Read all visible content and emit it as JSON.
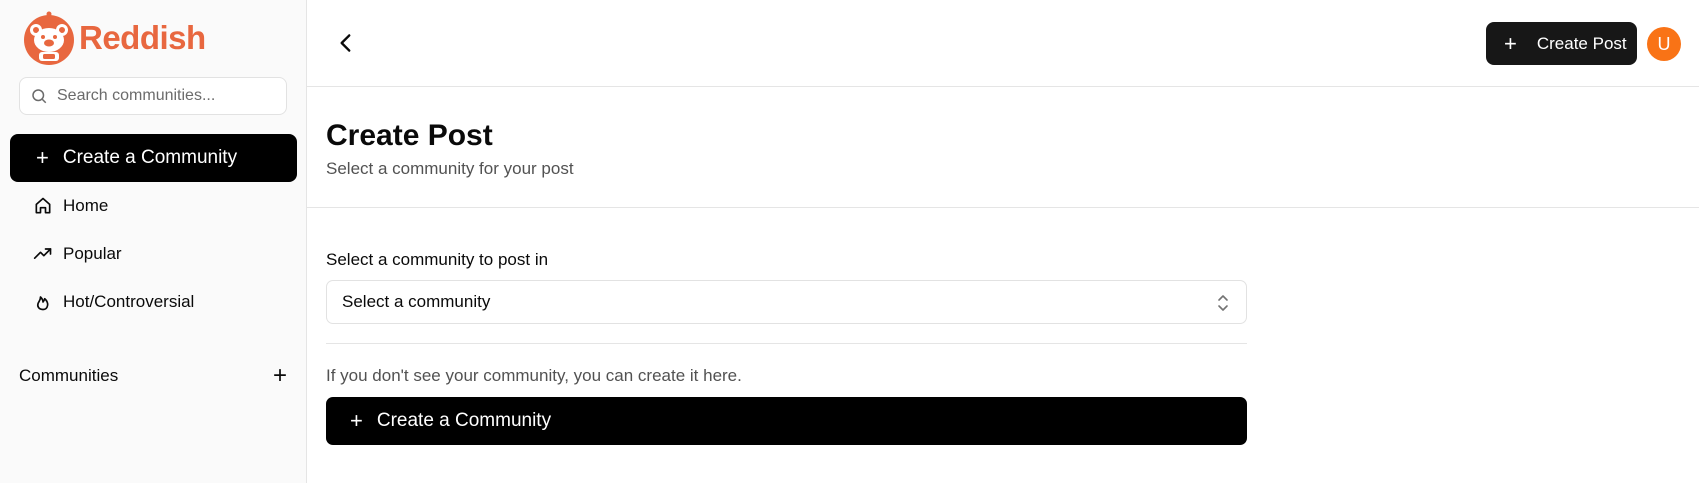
{
  "app": {
    "name": "Reddish",
    "brand_color": "#e8673f"
  },
  "sidebar": {
    "search_placeholder": "Search communities...",
    "create_community_label": "Create a Community",
    "nav": [
      {
        "label": "Home",
        "icon": "home-icon"
      },
      {
        "label": "Popular",
        "icon": "trending-up-icon"
      },
      {
        "label": "Hot/Controversial",
        "icon": "flame-icon"
      }
    ],
    "communities_label": "Communities"
  },
  "topbar": {
    "create_post_label": "Create Post",
    "avatar_initial": "U",
    "avatar_color": "#f97316"
  },
  "page": {
    "title": "Create Post",
    "subtitle": "Select a community for your post",
    "select_label": "Select a community to post in",
    "select_value": "Select a community",
    "hint": "If you don't see your community, you can create it here.",
    "create_community_label": "Create a Community"
  }
}
